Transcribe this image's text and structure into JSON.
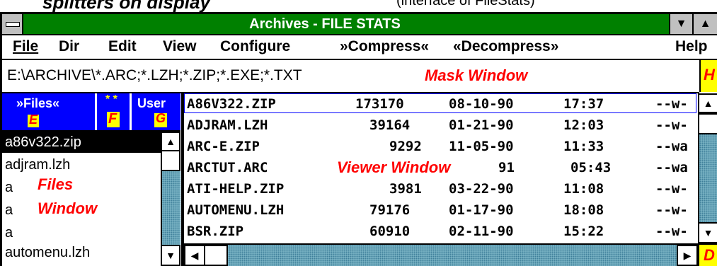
{
  "top_caption": "splitters on display",
  "top_caption_right": "(interface of FileStats)",
  "window": {
    "title": "Archives - FILE STATS"
  },
  "menu": {
    "file": "File",
    "dir": "Dir",
    "edit": "Edit",
    "view": "View",
    "configure": "Configure",
    "compress": "»Compress«",
    "decompress": "«Decompress»",
    "help": "Help"
  },
  "mask": {
    "value": "E:\\ARCHIVE\\*.ARC;*.LZH;*.ZIP;*.EXE;*.TXT",
    "label": "Mask Window",
    "side_letter": "H"
  },
  "files_panel": {
    "buttons": [
      {
        "label": "»Files«",
        "letter": "E"
      },
      {
        "label": "* *",
        "letter": "F"
      },
      {
        "label": "User",
        "letter": "G"
      }
    ],
    "items": [
      "a86v322.zip",
      "adjram.lzh",
      "a",
      "a",
      "a",
      "automenu.lzh"
    ],
    "label_line1": "Files",
    "label_line2": "Window"
  },
  "viewer": {
    "label": "Viewer Window",
    "rows": [
      {
        "name": "A86V322.ZIP",
        "size": "173170",
        "date": "08-10-90",
        "time": "17:37",
        "attr": "--w-"
      },
      {
        "name": "ADJRAM.LZH",
        "size": "39164",
        "date": "01-21-90",
        "time": "12:03",
        "attr": "--w-"
      },
      {
        "name": "ARC-E.ZIP",
        "size": "9292",
        "date": "11-05-90",
        "time": "11:33",
        "attr": "--wa"
      },
      {
        "name": "ARCTUT.ARC",
        "size": "",
        "date": "91",
        "time": "05:43",
        "attr": "--wa"
      },
      {
        "name": "ATI-HELP.ZIP",
        "size": "3981",
        "date": "03-22-90",
        "time": "11:08",
        "attr": "--w-"
      },
      {
        "name": "AUTOMENU.LZH",
        "size": "79176",
        "date": "01-17-90",
        "time": "18:08",
        "attr": "--w-"
      },
      {
        "name": "BSR.ZIP",
        "size": "60910",
        "date": "02-11-90",
        "time": "15:22",
        "attr": "--w-"
      }
    ],
    "side_letter": "D"
  },
  "colors": {
    "title_bar": "#008000",
    "files_header": "#0000ff",
    "selection": "#000000",
    "label_red": "#ff0000",
    "marker_yellow": "#ffff00"
  }
}
